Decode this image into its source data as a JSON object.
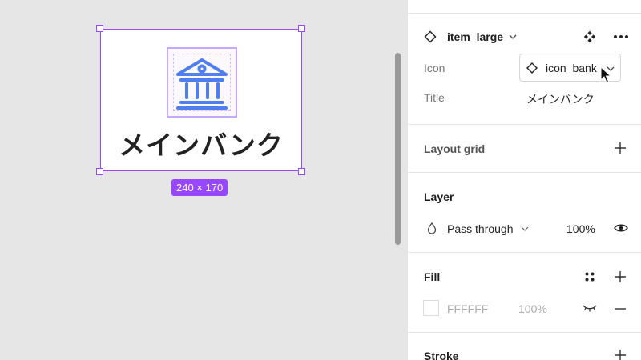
{
  "canvas": {
    "frame_title": "メインバンク",
    "frame_size": "240 × 170",
    "frame_icon": "bank-icon",
    "accent_color": "#9747ff",
    "icon_color": "#4f7ef0"
  },
  "panel": {
    "component": {
      "name": "item_large",
      "icon": "component-diamond-icon"
    },
    "properties": {
      "icon_label": "Icon",
      "icon_value": "icon_bank",
      "title_label": "Title",
      "title_value": "メインバンク"
    },
    "layout_grid": {
      "label": "Layout grid"
    },
    "layer": {
      "label": "Layer",
      "blend_mode": "Pass through",
      "opacity": "100%"
    },
    "fill": {
      "label": "Fill",
      "hex": "FFFFFF",
      "opacity": "100%",
      "swatch_color": "#ffffff"
    },
    "stroke": {
      "label": "Stroke"
    }
  }
}
